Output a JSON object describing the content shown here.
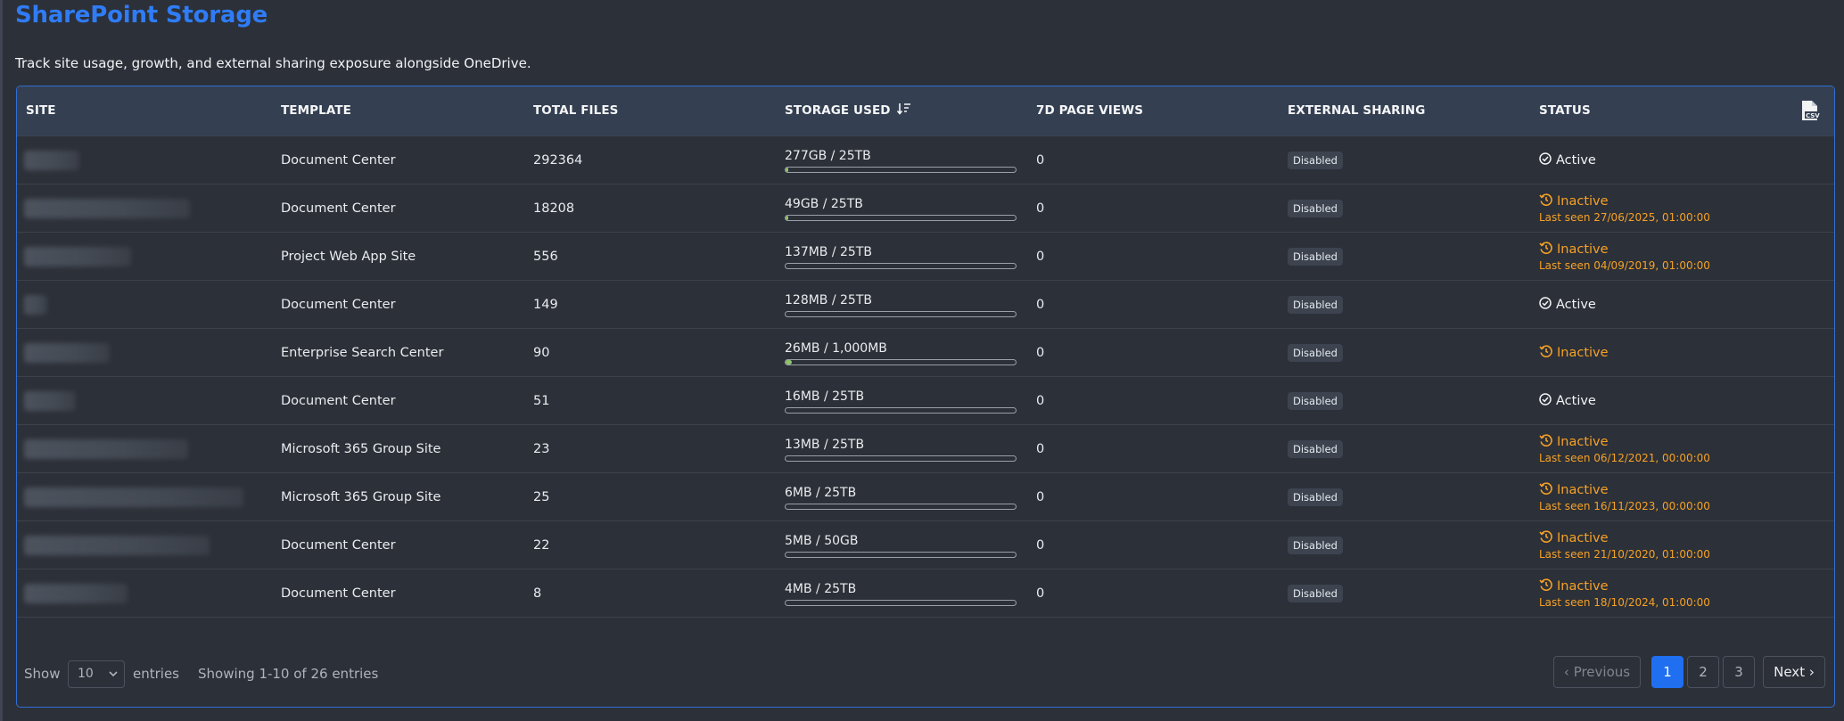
{
  "header": {
    "title": "SharePoint Storage",
    "subtitle": "Track site usage, growth, and external sharing exposure alongside OneDrive."
  },
  "table": {
    "columns": [
      "SITE",
      "TEMPLATE",
      "TOTAL FILES",
      "STORAGE USED",
      "7D PAGE VIEWS",
      "EXTERNAL SHARING",
      "STATUS"
    ],
    "export_icon": "csv-file-icon",
    "sort_icon": "sort-descending-icon",
    "rows": [
      {
        "template": "Document Center",
        "total_files": "292364",
        "storage": "277GB / 25TB",
        "storage_pct": 1.1,
        "views": "0",
        "sharing": "Disabled",
        "status": "Active",
        "last_seen": ""
      },
      {
        "template": "Document Center",
        "total_files": "18208",
        "storage": "49GB / 25TB",
        "storage_pct": 0.2,
        "views": "0",
        "sharing": "Disabled",
        "status": "Inactive",
        "last_seen": "Last seen 27/06/2025, 01:00:00"
      },
      {
        "template": "Project Web App Site",
        "total_files": "556",
        "storage": "137MB / 25TB",
        "storage_pct": 0.0,
        "views": "0",
        "sharing": "Disabled",
        "status": "Inactive",
        "last_seen": "Last seen 04/09/2019, 01:00:00"
      },
      {
        "template": "Document Center",
        "total_files": "149",
        "storage": "128MB / 25TB",
        "storage_pct": 0.0,
        "views": "0",
        "sharing": "Disabled",
        "status": "Active",
        "last_seen": ""
      },
      {
        "template": "Enterprise Search Center",
        "total_files": "90",
        "storage": "26MB / 1,000MB",
        "storage_pct": 2.6,
        "views": "0",
        "sharing": "Disabled",
        "status": "Inactive",
        "last_seen": ""
      },
      {
        "template": "Document Center",
        "total_files": "51",
        "storage": "16MB / 25TB",
        "storage_pct": 0.0,
        "views": "0",
        "sharing": "Disabled",
        "status": "Active",
        "last_seen": ""
      },
      {
        "template": "Microsoft 365 Group Site",
        "total_files": "23",
        "storage": "13MB / 25TB",
        "storage_pct": 0.0,
        "views": "0",
        "sharing": "Disabled",
        "status": "Inactive",
        "last_seen": "Last seen 06/12/2021, 00:00:00"
      },
      {
        "template": "Microsoft 365 Group Site",
        "total_files": "25",
        "storage": "6MB / 25TB",
        "storage_pct": 0.0,
        "views": "0",
        "sharing": "Disabled",
        "status": "Inactive",
        "last_seen": "Last seen 16/11/2023, 00:00:00"
      },
      {
        "template": "Document Center",
        "total_files": "22",
        "storage": "5MB / 50GB",
        "storage_pct": 0.0,
        "views": "0",
        "sharing": "Disabled",
        "status": "Inactive",
        "last_seen": "Last seen 21/10/2020, 01:00:00"
      },
      {
        "template": "Document Center",
        "total_files": "8",
        "storage": "4MB / 25TB",
        "storage_pct": 0.0,
        "views": "0",
        "sharing": "Disabled",
        "status": "Inactive",
        "last_seen": "Last seen 18/10/2024, 01:00:00"
      }
    ]
  },
  "footer": {
    "show_label": "Show",
    "entries_value": "10",
    "entries_label": "entries",
    "showing_text": "Showing 1-10 of 26 entries",
    "pagination": {
      "previous": "Previous",
      "pages": [
        "1",
        "2",
        "3"
      ],
      "current_page": "1",
      "next": "Next"
    }
  },
  "colors": {
    "title": "#2f7cf6",
    "inactive": "#f5a126",
    "accent": "#1f6ff0",
    "progress": "#8fc36a"
  }
}
